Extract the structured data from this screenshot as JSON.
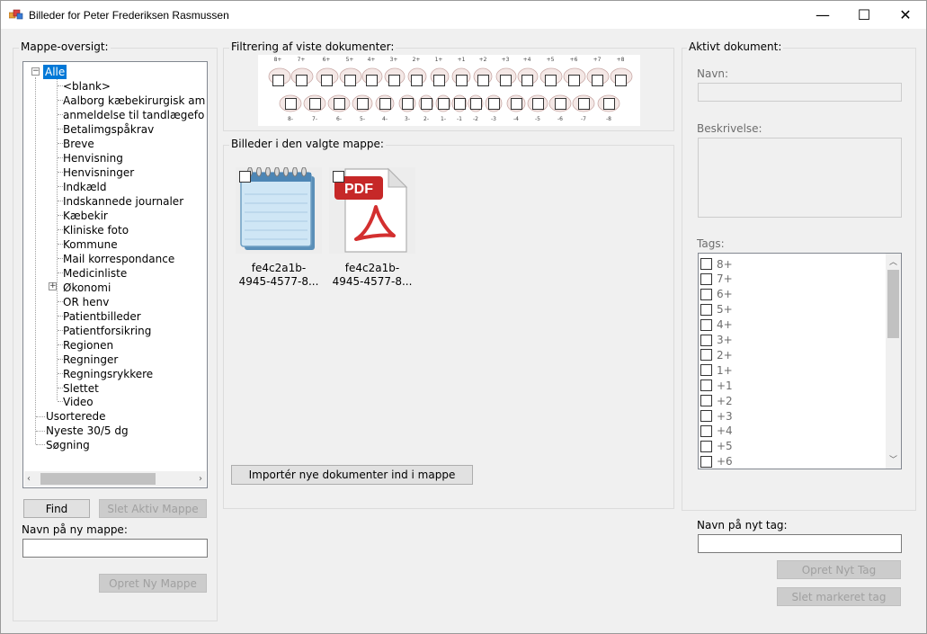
{
  "window": {
    "title": "Billeder for Peter Frederiksen Rasmussen",
    "minimize": "—",
    "maximize": "☐",
    "close": "✕"
  },
  "folders": {
    "group_label": "Mappe-oversigt:",
    "root": "Alle",
    "children": [
      "<blank>",
      "Aalborg kæbekirurgisk am",
      "anmeldelse til tandlægefo",
      "Betalimgspåkrav",
      "Breve",
      "Henvisning",
      "Henvisninger",
      "Indkæld",
      "Indskannede journaler",
      "Kæbekir",
      "Kliniske foto",
      "Kommune",
      "Mail korrespondance",
      "Medicinliste",
      "Økonomi",
      "OR henv",
      "Patientbilleder",
      "Patientforsikring",
      "Regionen",
      "Regninger",
      "Regningsrykkere",
      "Slettet",
      "Video"
    ],
    "top_level": [
      "Usorterede",
      "Nyeste 30/5 dg",
      "Søgning"
    ],
    "find_button": "Find",
    "delete_button": "Slet Aktiv Mappe",
    "new_folder_label": "Navn på ny mappe:",
    "new_folder_value": "",
    "create_button": "Opret Ny Mappe"
  },
  "filter": {
    "group_label": "Filtrering af viste dokumenter:",
    "upper_numbers": [
      "8+",
      "7+",
      "6+",
      "5+",
      "4+",
      "3+",
      "2+",
      "1+",
      "+1",
      "+2",
      "+3",
      "+4",
      "+5",
      "+6",
      "+7",
      "+8"
    ],
    "lower_numbers": [
      "8-",
      "7-",
      "6-",
      "5-",
      "4-",
      "3-",
      "2-",
      "1-",
      "-1",
      "-2",
      "-3",
      "-4",
      "-5",
      "-6",
      "-7",
      "-8"
    ]
  },
  "images": {
    "group_label": "Billeder i den valgte mappe:",
    "items": [
      {
        "icon": "notepad-icon",
        "caption1": "fe4c2a1b-",
        "caption2": "4945-4577-8..."
      },
      {
        "icon": "pdf-icon",
        "caption1": "fe4c2a1b-",
        "caption2": "4945-4577-8..."
      }
    ],
    "import_button": "Importér nye dokumenter ind i mappe"
  },
  "active_document": {
    "group_label": "Aktivt dokument:",
    "name_label": "Navn:",
    "name_value": "",
    "description_label": "Beskrivelse:",
    "description_value": "",
    "tags_label": "Tags:",
    "tags": [
      "8+",
      "7+",
      "6+",
      "5+",
      "4+",
      "3+",
      "2+",
      "1+",
      "+1",
      "+2",
      "+3",
      "+4",
      "+5",
      "+6"
    ],
    "new_tag_label": "Navn på nyt tag:",
    "new_tag_value": "",
    "create_tag_button": "Opret Nyt Tag",
    "delete_tag_button": "Slet markeret tag"
  },
  "colors": {
    "selection": "#0078d7",
    "pdf_red": "#d32f2f"
  }
}
